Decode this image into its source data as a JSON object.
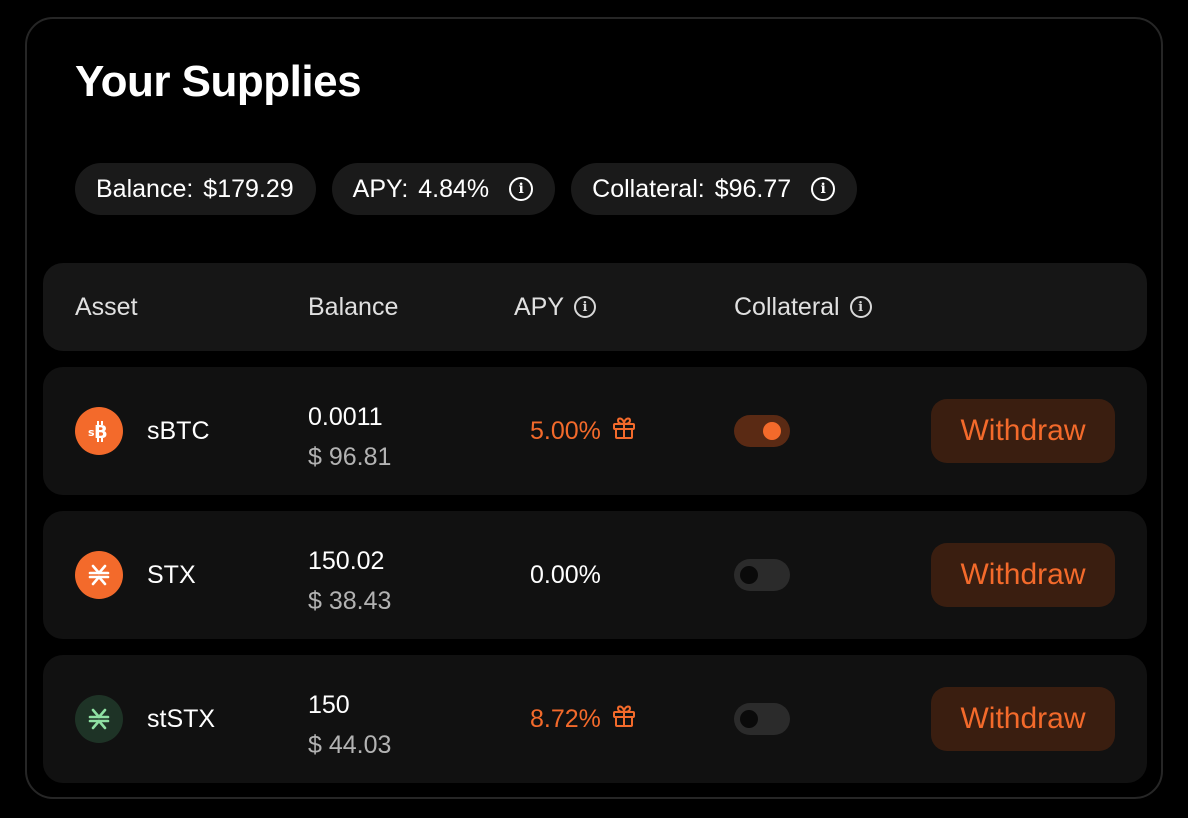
{
  "title": "Your Supplies",
  "summary": {
    "balance_label": "Balance:",
    "balance_value": "$179.29",
    "apy_label": "APY:",
    "apy_value": "4.84%",
    "collateral_label": "Collateral:",
    "collateral_value": "$96.77"
  },
  "table": {
    "headers": {
      "asset": "Asset",
      "balance": "Balance",
      "apy": "APY",
      "collateral": "Collateral"
    },
    "rows": [
      {
        "symbol": "sBTC",
        "icon": "sbtc-token-icon",
        "amount": "0.0011",
        "usd": "$ 96.81",
        "apy": "5.00%",
        "apy_color": "#f36a2b",
        "has_reward": true,
        "collateral_enabled": true,
        "action": "Withdraw"
      },
      {
        "symbol": "STX",
        "icon": "stx-token-icon",
        "amount": "150.02",
        "usd": "$ 38.43",
        "apy": "0.00%",
        "apy_color": "#ffffff",
        "has_reward": false,
        "collateral_enabled": false,
        "action": "Withdraw"
      },
      {
        "symbol": "stSTX",
        "icon": "ststx-token-icon",
        "amount": "150",
        "usd": "$ 44.03",
        "apy": "8.72%",
        "apy_color": "#f36a2b",
        "has_reward": true,
        "collateral_enabled": false,
        "action": "Withdraw"
      }
    ]
  },
  "colors": {
    "accent": "#f36a2b",
    "button_bg": "#3a1e10",
    "card_bg": "#111111",
    "header_bg": "#161616"
  }
}
